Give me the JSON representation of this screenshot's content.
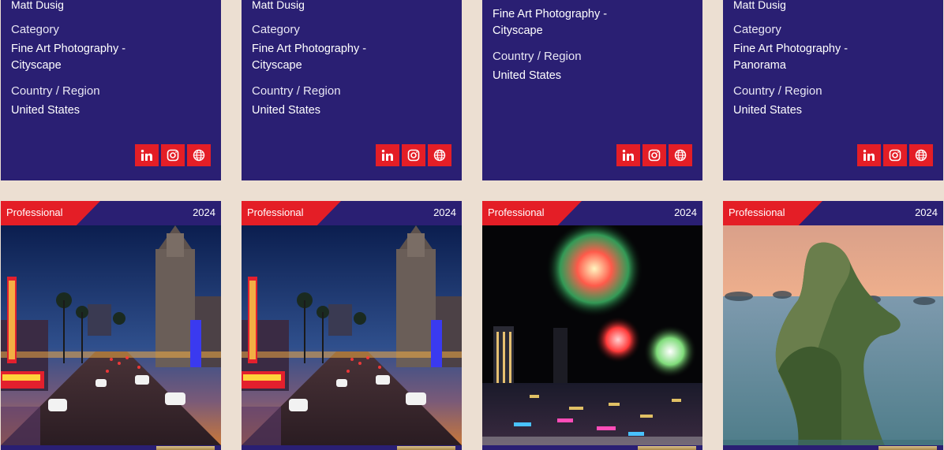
{
  "info_cards": [
    {
      "name": "Matt Dusig",
      "category_label": "Category",
      "category_line1": "Fine Art Photography -",
      "category_line2": "Cityscape",
      "country_label": "Country / Region",
      "country": "United States"
    },
    {
      "name": "Matt Dusig",
      "category_label": "Category",
      "category_line1": "Fine Art Photography -",
      "category_line2": "Cityscape",
      "country_label": "Country / Region",
      "country": "United States"
    },
    {
      "name": "",
      "category_label": "",
      "category_line1": "Fine Art Photography -",
      "category_line2": "Cityscape",
      "country_label": "Country / Region",
      "country": "United States"
    },
    {
      "name": "Matt Dusig",
      "category_label": "Category",
      "category_line1": "Fine Art Photography -",
      "category_line2": "Panorama",
      "country_label": "Country / Region",
      "country": "United States"
    }
  ],
  "social_icons": [
    "linkedin-icon",
    "instagram-icon",
    "globe-icon"
  ],
  "photo_cards": [
    {
      "badge": "Professional",
      "year": "2024",
      "subject": "hollywood-boulevard"
    },
    {
      "badge": "Professional",
      "year": "2024",
      "subject": "hollywood-boulevard"
    },
    {
      "badge": "Professional",
      "year": "2024",
      "subject": "fireworks-over-river"
    },
    {
      "badge": "Professional",
      "year": "2024",
      "subject": "limestone-island"
    }
  ],
  "colors": {
    "card": "#2a1f73",
    "accent": "#e41e26",
    "background": "#ecdfd2",
    "gold": "#c9a96a"
  }
}
